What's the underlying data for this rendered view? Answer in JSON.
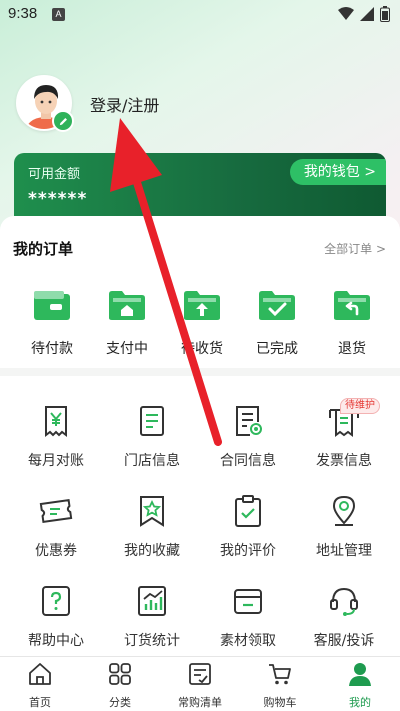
{
  "status_bar": {
    "time": "9:38",
    "notification": "A"
  },
  "profile": {
    "login_label": "登录/注册"
  },
  "wallet": {
    "label": "可用金额",
    "amount": "******",
    "link": "我的钱包 >"
  },
  "orders": {
    "title": "我的订单",
    "all_label": "全部订单 >",
    "items": [
      {
        "label": "待付款",
        "icon": "wallet-card-icon"
      },
      {
        "label": "支付中",
        "icon": "folder-home-icon"
      },
      {
        "label": "待收货",
        "icon": "folder-upload-icon"
      },
      {
        "label": "已完成",
        "icon": "folder-check-icon"
      },
      {
        "label": "退货",
        "icon": "folder-return-icon"
      }
    ]
  },
  "services": {
    "badge": "待维护",
    "items": [
      {
        "label": "每月对账",
        "icon": "receipt-yen-icon"
      },
      {
        "label": "门店信息",
        "icon": "document-icon"
      },
      {
        "label": "合同信息",
        "icon": "contract-icon"
      },
      {
        "label": "发票信息",
        "icon": "invoice-icon"
      },
      {
        "label": "优惠券",
        "icon": "coupon-icon"
      },
      {
        "label": "我的收藏",
        "icon": "bookmark-star-icon"
      },
      {
        "label": "我的评价",
        "icon": "clipboard-check-icon"
      },
      {
        "label": "地址管理",
        "icon": "location-pin-icon"
      },
      {
        "label": "帮助中心",
        "icon": "help-icon"
      },
      {
        "label": "订货统计",
        "icon": "chart-icon"
      },
      {
        "label": "素材领取",
        "icon": "wallet-folder-icon"
      },
      {
        "label": "客服/投诉",
        "icon": "headset-icon"
      }
    ]
  },
  "nav": {
    "items": [
      {
        "label": "首页",
        "icon": "home-icon"
      },
      {
        "label": "分类",
        "icon": "grid-icon"
      },
      {
        "label": "常购清单",
        "icon": "list-icon"
      },
      {
        "label": "购物车",
        "icon": "cart-icon"
      },
      {
        "label": "我的",
        "icon": "user-icon"
      }
    ],
    "active": "我的"
  },
  "colors": {
    "accent": "#1e9b4f",
    "wallet": "#176b3f",
    "arrow": "#e8212a"
  }
}
